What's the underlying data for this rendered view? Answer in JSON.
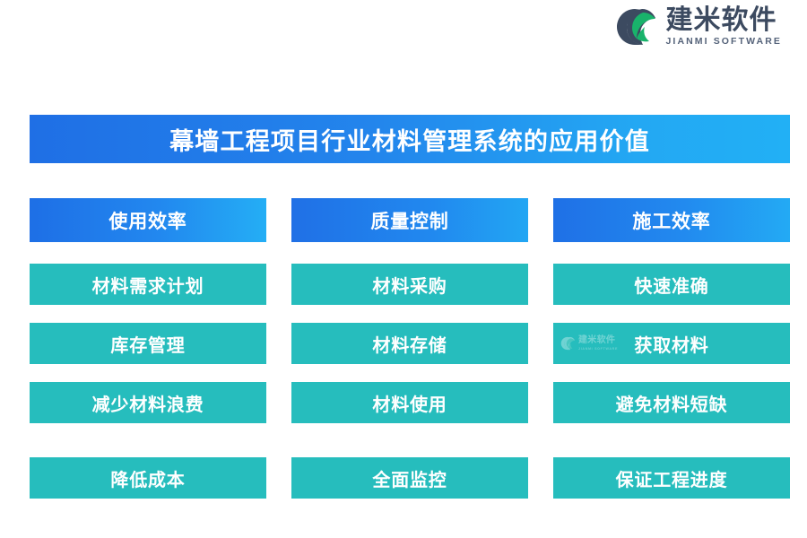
{
  "brand": {
    "logo_icon": "jianmi-leaf-logo-icon",
    "name_cn": "建米软件",
    "name_en": "JIANMI SOFTWARE",
    "color_dark": "#3c4a60",
    "color_green": "#19b36b"
  },
  "title_banner": {
    "text": "幕墙工程项目行业材料管理系统的应用价值",
    "gradient_from": "#1f6fe5",
    "gradient_to": "#22b0f5"
  },
  "colors": {
    "header_blue_start": "#1e6fe6",
    "header_blue_end": "#24aef5",
    "card_teal": "#26bdbd",
    "page_background": "#ffffff"
  },
  "columns": [
    {
      "header": "使用效率",
      "items": [
        "材料需求计划",
        "库存管理",
        "减少材料浪费"
      ],
      "footer": "降低成本"
    },
    {
      "header": "质量控制",
      "items": [
        "材料采购",
        "材料存储",
        "材料使用"
      ],
      "footer": "全面监控"
    },
    {
      "header": "施工效率",
      "items": [
        "快速准确",
        "获取材料",
        "避免材料短缺"
      ],
      "footer": "保证工程进度"
    }
  ],
  "watermark": {
    "name_cn": "建米软件",
    "name_en": "JIANMI SOFTWARE",
    "in_card": "获取材料"
  }
}
